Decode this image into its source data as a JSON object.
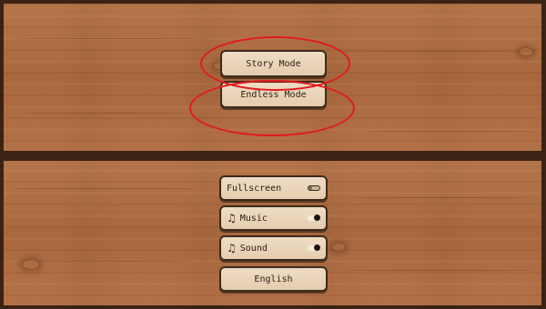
{
  "menu": {
    "story_label": "Story Mode",
    "endless_label": "Endless Mode"
  },
  "settings": {
    "fullscreen": {
      "label": "Fullscreen",
      "state": "off"
    },
    "music": {
      "label": "Music",
      "icon": "music-note-icon",
      "state": "on"
    },
    "sound": {
      "label": "Sound",
      "icon": "music-note-icon",
      "state": "on"
    },
    "language": {
      "label": "English"
    }
  },
  "colors": {
    "wood": "#b06e43",
    "button_bg": "#e8d3b8",
    "button_border": "#3b2a1c",
    "annotation": "#e3191c"
  }
}
